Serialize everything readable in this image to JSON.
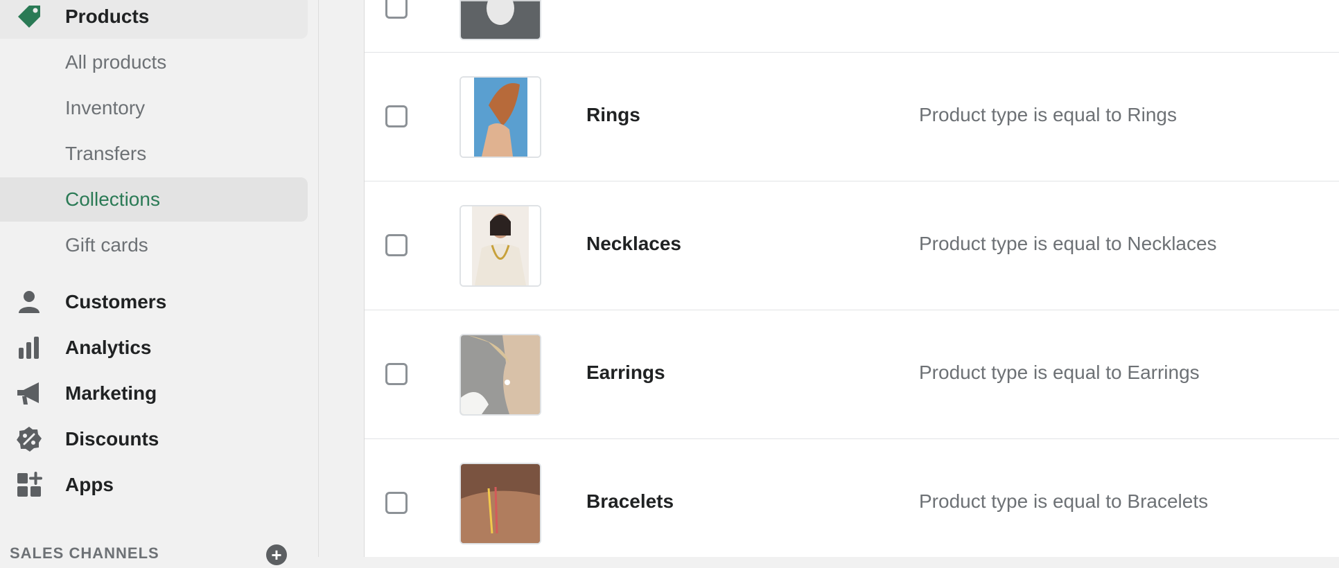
{
  "sidebar": {
    "products": {
      "label": "Products",
      "icon": "tag-icon"
    },
    "sub_items": [
      {
        "label": "All products"
      },
      {
        "label": "Inventory"
      },
      {
        "label": "Transfers"
      },
      {
        "label": "Collections",
        "selected": true
      },
      {
        "label": "Gift cards"
      }
    ],
    "items": [
      {
        "label": "Customers",
        "icon": "person-icon"
      },
      {
        "label": "Analytics",
        "icon": "bar-chart-icon"
      },
      {
        "label": "Marketing",
        "icon": "megaphone-icon"
      },
      {
        "label": "Discounts",
        "icon": "discount-icon"
      },
      {
        "label": "Apps",
        "icon": "apps-icon"
      }
    ],
    "sales_channels_label": "SALES CHANNELS"
  },
  "collections": [
    {
      "title": "Rings",
      "condition": "Product type is equal to Rings"
    },
    {
      "title": "Necklaces",
      "condition": "Product type is equal to Necklaces"
    },
    {
      "title": "Earrings",
      "condition": "Product type is equal to Earrings"
    },
    {
      "title": "Bracelets",
      "condition": "Product type is equal to Bracelets"
    }
  ],
  "colors": {
    "accent": "#2a7a55",
    "text": "#202223",
    "muted": "#6d7175"
  }
}
